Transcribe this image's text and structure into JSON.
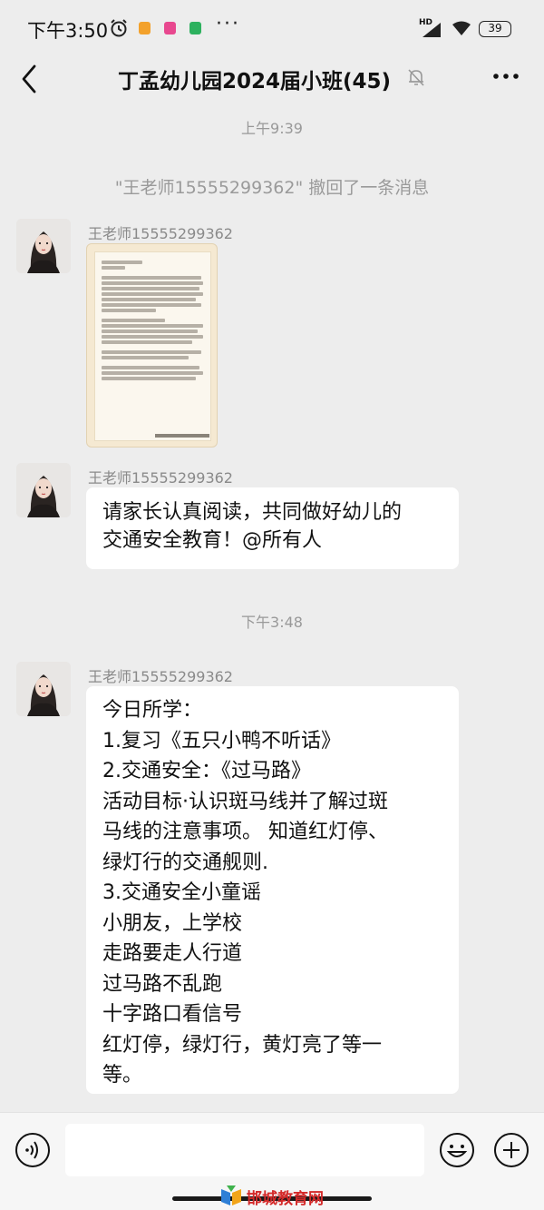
{
  "status_bar": {
    "time": "下午3:50",
    "network": "HD",
    "battery": "39"
  },
  "header": {
    "title": "丁孟幼儿园2024届小班(45)"
  },
  "chat": {
    "time_1": "上午9:39",
    "recall_notice": "\"王老师15555299362\" 撤回了一条消息",
    "msg_image": {
      "sender": "王老师15555299362"
    },
    "msg_text_1": {
      "sender": "王老师15555299362",
      "lines": [
        "请家长认真阅读，共同做好幼儿的",
        "交通安全教育！@所有人"
      ]
    },
    "time_2": "下午3:48",
    "msg_text_2": {
      "sender": "王老师15555299362",
      "lines": [
        "今日所学：",
        "1.复习《五只小鸭不听话》",
        "2.交通安全：《过马路》",
        "活动目标·认识斑马线并了解过斑",
        "马线的注意事项。 知道红灯停、",
        "绿灯行的交通舰则.",
        "3.交通安全小童谣",
        "小朋友，上学校",
        "走路要走人行道",
        "过马路不乱跑",
        "十字路口看信号",
        "红灯停，绿灯行，黄灯亮了等一",
        "等。"
      ]
    }
  },
  "input_bar": {
    "watermark": "邯城教育网"
  },
  "colors": {
    "background": "#ededed",
    "bubble": "#ffffff",
    "watermark_red": "#d42a2a"
  }
}
